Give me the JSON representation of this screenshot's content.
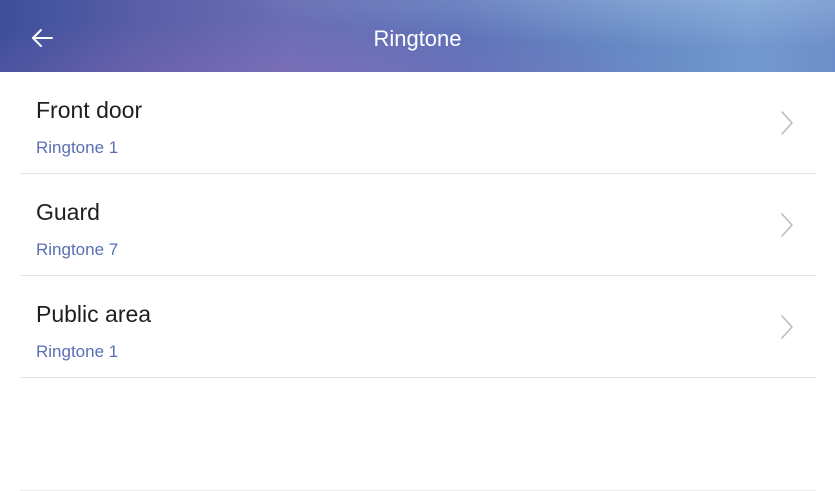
{
  "header": {
    "title": "Ringtone",
    "back_icon": "arrow-left-icon"
  },
  "items": [
    {
      "label": "Front door",
      "value": "Ringtone 1",
      "icon": "chevron-right-icon"
    },
    {
      "label": "Guard",
      "value": "Ringtone 7",
      "icon": "chevron-right-icon"
    },
    {
      "label": "Public area",
      "value": "Ringtone 1",
      "icon": "chevron-right-icon"
    }
  ],
  "colors": {
    "header_gradient_start": "#3d4f9a",
    "header_gradient_end": "#7399cf",
    "value_text": "#5a6fb4",
    "divider": "#e4e4e4"
  }
}
